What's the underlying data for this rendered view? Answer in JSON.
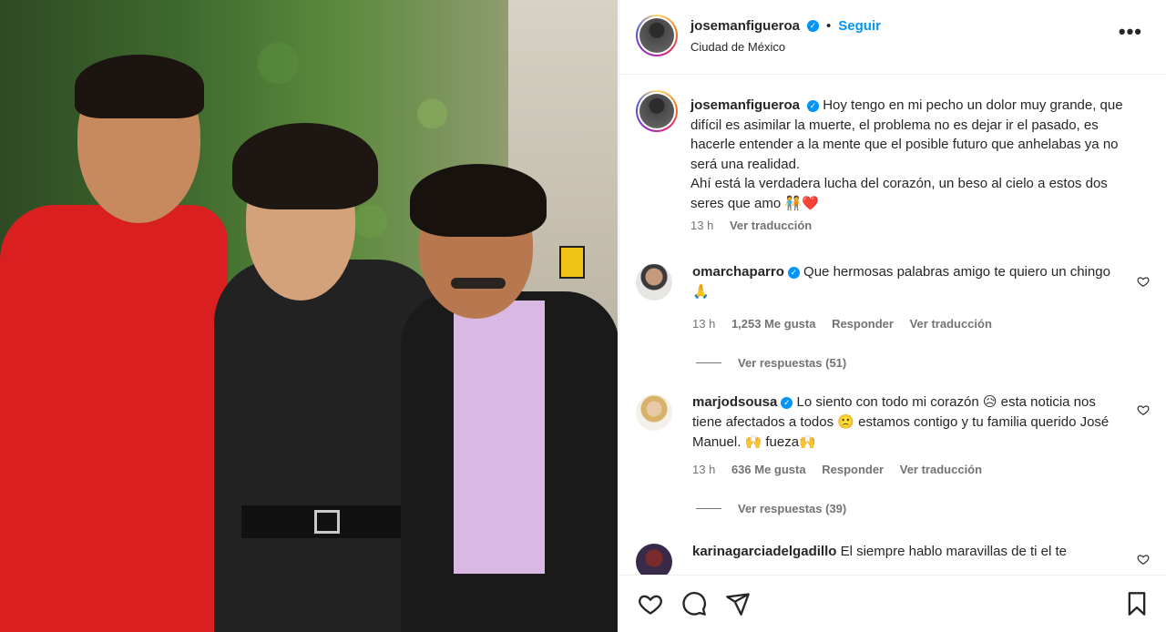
{
  "post": {
    "username": "josemanfigueroa",
    "follow_label": "Seguir",
    "separator": "•",
    "location": "Ciudad de México",
    "more_label": "•••"
  },
  "caption": {
    "username": "josemanfigueroa",
    "text1": "Hoy tengo en mi pecho un dolor muy grande, que difícil es asimilar la muerte, el problema no es dejar ir el pasado, es hacerle entender a la mente que el posible futuro que anhelabas ya no será una realidad.",
    "text2": "Ahí está la verdadera lucha del corazón, un beso al cielo a estos dos seres que amo 🧑‍🤝‍🧑❤️",
    "time": "13 h",
    "translate": "Ver traducción"
  },
  "comments": [
    {
      "username": "omarchaparro",
      "text": "Que hermosas palabras amigo te quiero un chingo 🙏",
      "time": "13 h",
      "likes": "1,253 Me gusta",
      "reply": "Responder",
      "translate": "Ver traducción",
      "replies": "Ver respuestas (51)"
    },
    {
      "username": "marjodsousa",
      "text": "Lo siento con todo mi corazón 😥 esta noticia nos tiene afectados a todos 🙁 estamos contigo y tu familia querido José Manuel. 🙌 fueza🙌",
      "time": "13 h",
      "likes": "636 Me gusta",
      "reply": "Responder",
      "translate": "Ver traducción",
      "replies": "Ver respuestas (39)"
    },
    {
      "username": "karinagarciadelgadillo",
      "text": "El siempre hablo maravillas de ti el te"
    }
  ],
  "icons": {
    "like": "heart-icon",
    "comment": "comment-icon",
    "share": "share-icon",
    "save": "bookmark-icon"
  },
  "colors": {
    "link_blue": "#0095f6",
    "verified_blue": "#0095f6",
    "muted_text": "#737373"
  }
}
